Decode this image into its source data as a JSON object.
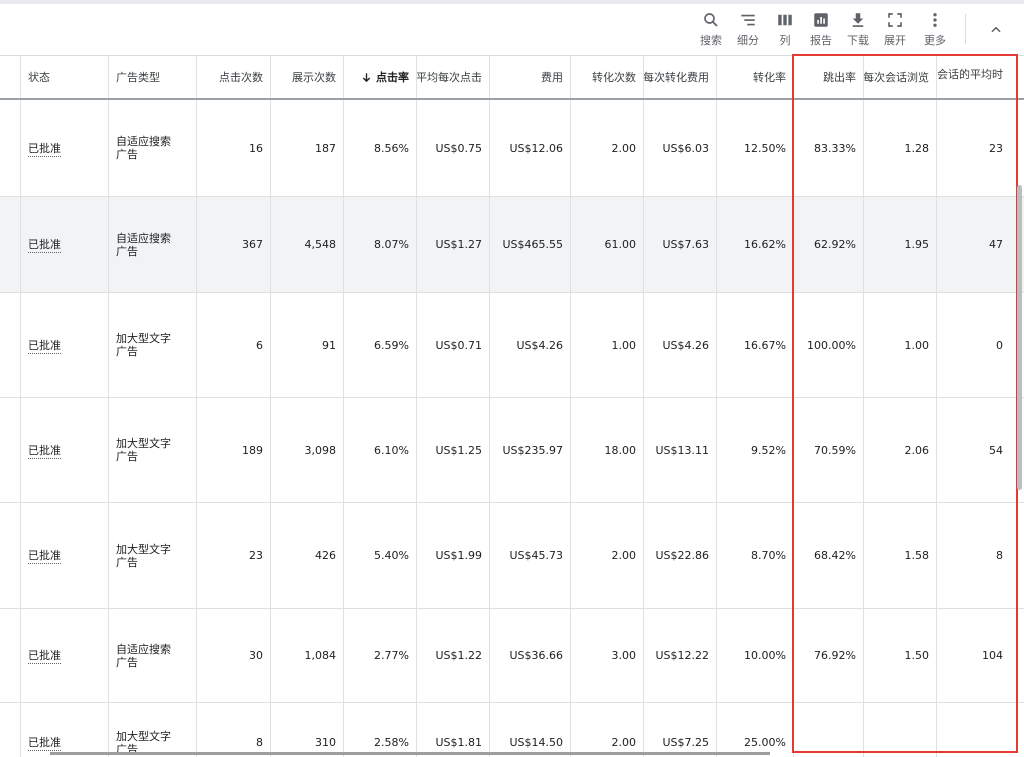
{
  "toolbar": {
    "items": [
      {
        "label": "搜索",
        "icon": "search-icon"
      },
      {
        "label": "细分",
        "icon": "segment-icon"
      },
      {
        "label": "列",
        "icon": "columns-icon"
      },
      {
        "label": "报告",
        "icon": "report-icon"
      },
      {
        "label": "下载",
        "icon": "download-icon"
      },
      {
        "label": "展开",
        "icon": "expand-icon"
      },
      {
        "label": "更多",
        "icon": "more-vert-icon"
      }
    ]
  },
  "columns": [
    "状态",
    "广告类型",
    "点击次数",
    "展示次数",
    "点击率",
    "平均每次点击",
    "费用",
    "转化次数",
    "每次转化费用",
    "转化率",
    "跳出率",
    "每次会话浏览",
    "会话的平均时"
  ],
  "sort_column": "点击率",
  "rows": [
    [
      "已批准",
      "自适应搜索广告",
      "16",
      "187",
      "8.56%",
      "US$0.75",
      "US$12.06",
      "2.00",
      "US$6.03",
      "12.50%",
      "83.33%",
      "1.28",
      "23"
    ],
    [
      "已批准",
      "自适应搜索广告",
      "367",
      "4,548",
      "8.07%",
      "US$1.27",
      "US$465.55",
      "61.00",
      "US$7.63",
      "16.62%",
      "62.92%",
      "1.95",
      "47"
    ],
    [
      "已批准",
      "加大型文字广告",
      "6",
      "91",
      "6.59%",
      "US$0.71",
      "US$4.26",
      "1.00",
      "US$4.26",
      "16.67%",
      "100.00%",
      "1.00",
      "0"
    ],
    [
      "已批准",
      "加大型文字广告",
      "189",
      "3,098",
      "6.10%",
      "US$1.25",
      "US$235.97",
      "18.00",
      "US$13.11",
      "9.52%",
      "70.59%",
      "2.06",
      "54"
    ],
    [
      "已批准",
      "加大型文字广告",
      "23",
      "426",
      "5.40%",
      "US$1.99",
      "US$45.73",
      "2.00",
      "US$22.86",
      "8.70%",
      "68.42%",
      "1.58",
      "8"
    ],
    [
      "已批准",
      "自适应搜索广告",
      "30",
      "1,084",
      "2.77%",
      "US$1.22",
      "US$36.66",
      "3.00",
      "US$12.22",
      "10.00%",
      "76.92%",
      "1.50",
      "104"
    ],
    [
      "已批准",
      "加大型文字广告",
      "8",
      "310",
      "2.58%",
      "US$1.81",
      "US$14.50",
      "2.00",
      "US$7.25",
      "25.00%",
      "",
      "",
      ""
    ]
  ],
  "highlight_row": 1,
  "colors": {
    "highlight": "#e53935",
    "row_hover": "#f1f3f4"
  }
}
